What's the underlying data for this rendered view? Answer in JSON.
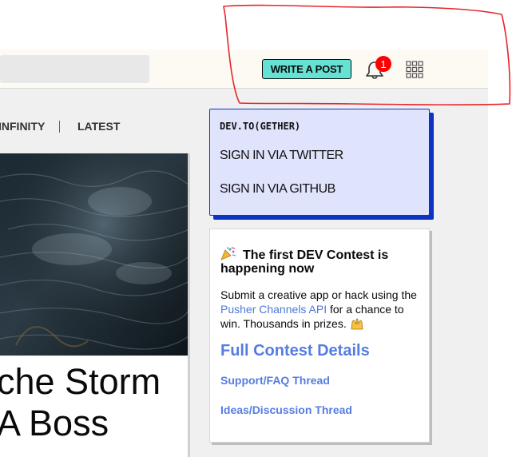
{
  "header": {
    "write_post_label": "WRITE A POST",
    "notification_count": "1",
    "accent_color": "#66e2d5",
    "badge_color": "#ff0000"
  },
  "feed_tabs": {
    "infinity_label": "INFINITY",
    "latest_label": "LATEST"
  },
  "article": {
    "title": "che Storm\nA Boss"
  },
  "signin_widget": {
    "heading": "DEV.TO(GETHER)",
    "twitter_label": "SIGN IN VIA TWITTER",
    "github_label": "SIGN IN VIA GITHUB",
    "accent_color": "#0d33c4"
  },
  "contest_widget": {
    "heading": "The first DEV Contest is happening now",
    "body_before": "Submit a creative app or hack using the ",
    "body_link": "Pusher Channels API",
    "body_after": " for a chance to win. Thousands in prizes. ",
    "details_label": "Full Contest Details",
    "faq_label": "Support/FAQ Thread",
    "ideas_label": "Ideas/Discussion Thread",
    "link_color": "#557de0"
  },
  "icons": {
    "bell": "bell-icon",
    "apps": "apps-grid-icon",
    "party": "party-popper-icon",
    "hands": "raised-hands-icon"
  }
}
